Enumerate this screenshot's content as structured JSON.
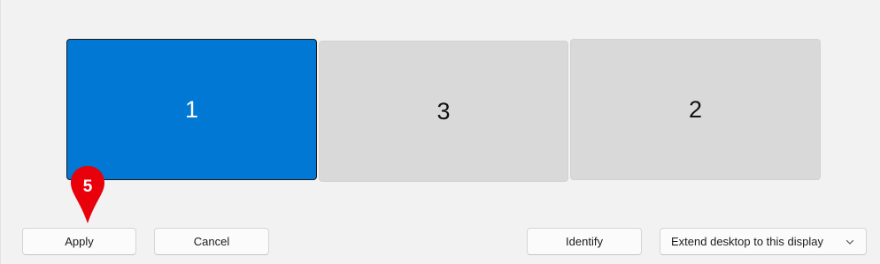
{
  "monitors": [
    {
      "label": "1",
      "selected": true,
      "color": "#0078d4"
    },
    {
      "label": "3",
      "selected": false,
      "color": "#d9d9d9"
    },
    {
      "label": "2",
      "selected": false,
      "color": "#d9d9d9"
    }
  ],
  "buttons": {
    "apply": "Apply",
    "cancel": "Cancel",
    "identify": "Identify"
  },
  "display_mode": {
    "selected": "Extend desktop to this display",
    "icon": "chevron-down-icon"
  },
  "annotation": {
    "step": "5",
    "color": "#e8000b",
    "icon": "map-pin-icon"
  }
}
